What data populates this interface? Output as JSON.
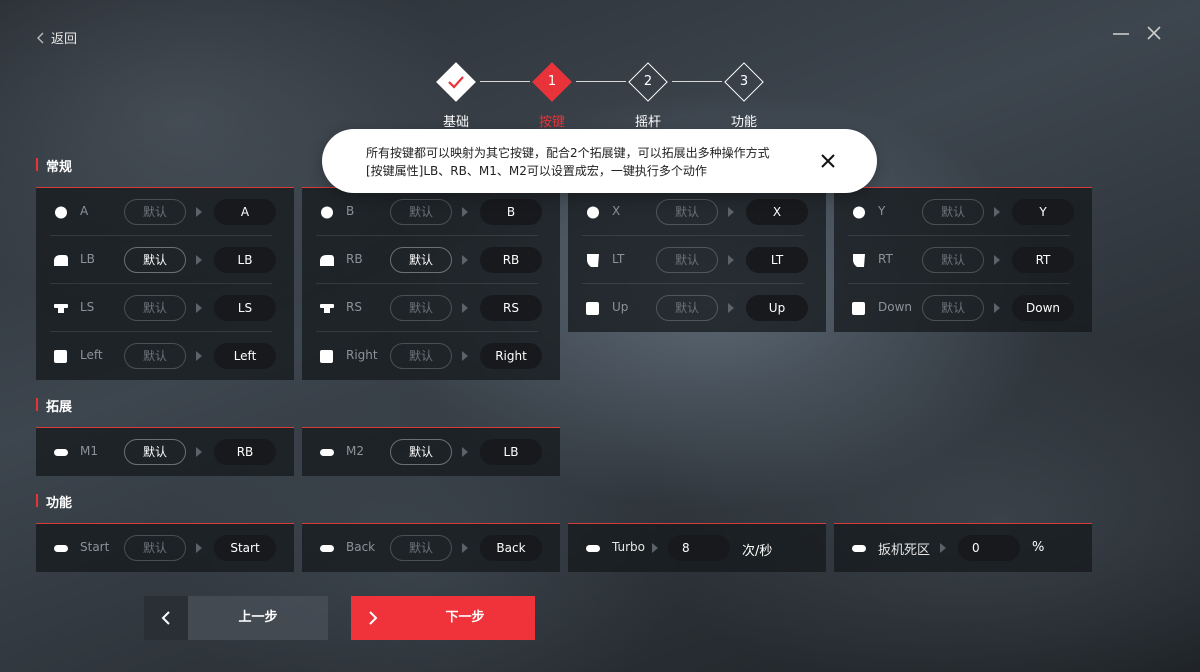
{
  "nav": {
    "back_label": "返回"
  },
  "stepper": [
    {
      "num": "",
      "label": "基础",
      "state": "done"
    },
    {
      "num": "1",
      "label": "按键",
      "state": "active"
    },
    {
      "num": "2",
      "label": "摇杆",
      "state": "todo"
    },
    {
      "num": "3",
      "label": "功能",
      "state": "todo"
    }
  ],
  "tooltip": {
    "line1": "所有按键都可以映射为其它按键，配合2个拓展键，可以拓展出多种操作方式",
    "line2": "[按键属性]LB、RB、M1、M2可以设置成宏，一键执行多个动作"
  },
  "sections": {
    "normal": "常规",
    "extend": "拓展",
    "function": "功能"
  },
  "default_label": "默认",
  "normal_panels": [
    {
      "rows": [
        {
          "icon": "circle-button-icon",
          "key": "A",
          "default_on": false,
          "map": "A"
        },
        {
          "icon": "bumper-icon",
          "key": "LB",
          "default_on": true,
          "map": "LB"
        },
        {
          "icon": "stick-press-icon",
          "key": "LS",
          "default_on": false,
          "map": "LS"
        },
        {
          "icon": "dpad-icon",
          "key": "Left",
          "default_on": false,
          "map": "Left"
        }
      ]
    },
    {
      "rows": [
        {
          "icon": "circle-button-icon",
          "key": "B",
          "default_on": false,
          "map": "B"
        },
        {
          "icon": "bumper-icon",
          "key": "RB",
          "default_on": true,
          "map": "RB"
        },
        {
          "icon": "stick-press-icon",
          "key": "RS",
          "default_on": false,
          "map": "RS"
        },
        {
          "icon": "dpad-icon",
          "key": "Right",
          "default_on": false,
          "map": "Right"
        }
      ]
    },
    {
      "rows": [
        {
          "icon": "circle-button-icon",
          "key": "X",
          "default_on": false,
          "map": "X"
        },
        {
          "icon": "trigger-icon",
          "key": "LT",
          "default_on": false,
          "map": "LT"
        },
        {
          "icon": "dpad-icon",
          "key": "Up",
          "default_on": false,
          "map": "Up"
        }
      ]
    },
    {
      "rows": [
        {
          "icon": "circle-button-icon",
          "key": "Y",
          "default_on": false,
          "map": "Y"
        },
        {
          "icon": "trigger-icon",
          "key": "RT",
          "default_on": false,
          "map": "RT"
        },
        {
          "icon": "dpad-icon",
          "key": "Down",
          "default_on": false,
          "map": "Down"
        }
      ]
    }
  ],
  "extend_panels": [
    {
      "icon": "pill-button-icon",
      "key": "M1",
      "default_on": true,
      "map": "RB"
    },
    {
      "icon": "pill-button-icon",
      "key": "M2",
      "default_on": true,
      "map": "LB"
    }
  ],
  "function_panels": {
    "start": {
      "icon": "pill-button-icon",
      "key": "Start",
      "default_on": false,
      "map": "Start"
    },
    "back": {
      "icon": "pill-button-icon",
      "key": "Back",
      "default_on": false,
      "map": "Back"
    },
    "turbo": {
      "icon": "pill-button-icon",
      "key": "Turbo",
      "value": "8",
      "unit": "次/秒"
    },
    "deadzone": {
      "icon": "pill-button-icon",
      "key": "扳机死区",
      "value": "0",
      "unit": "%"
    }
  },
  "footer": {
    "prev_label": "上一步",
    "next_label": "下一步"
  },
  "colors": {
    "accent": "#e8333a",
    "panel_bg": "#14171b",
    "pill_dark": "#17191c"
  }
}
